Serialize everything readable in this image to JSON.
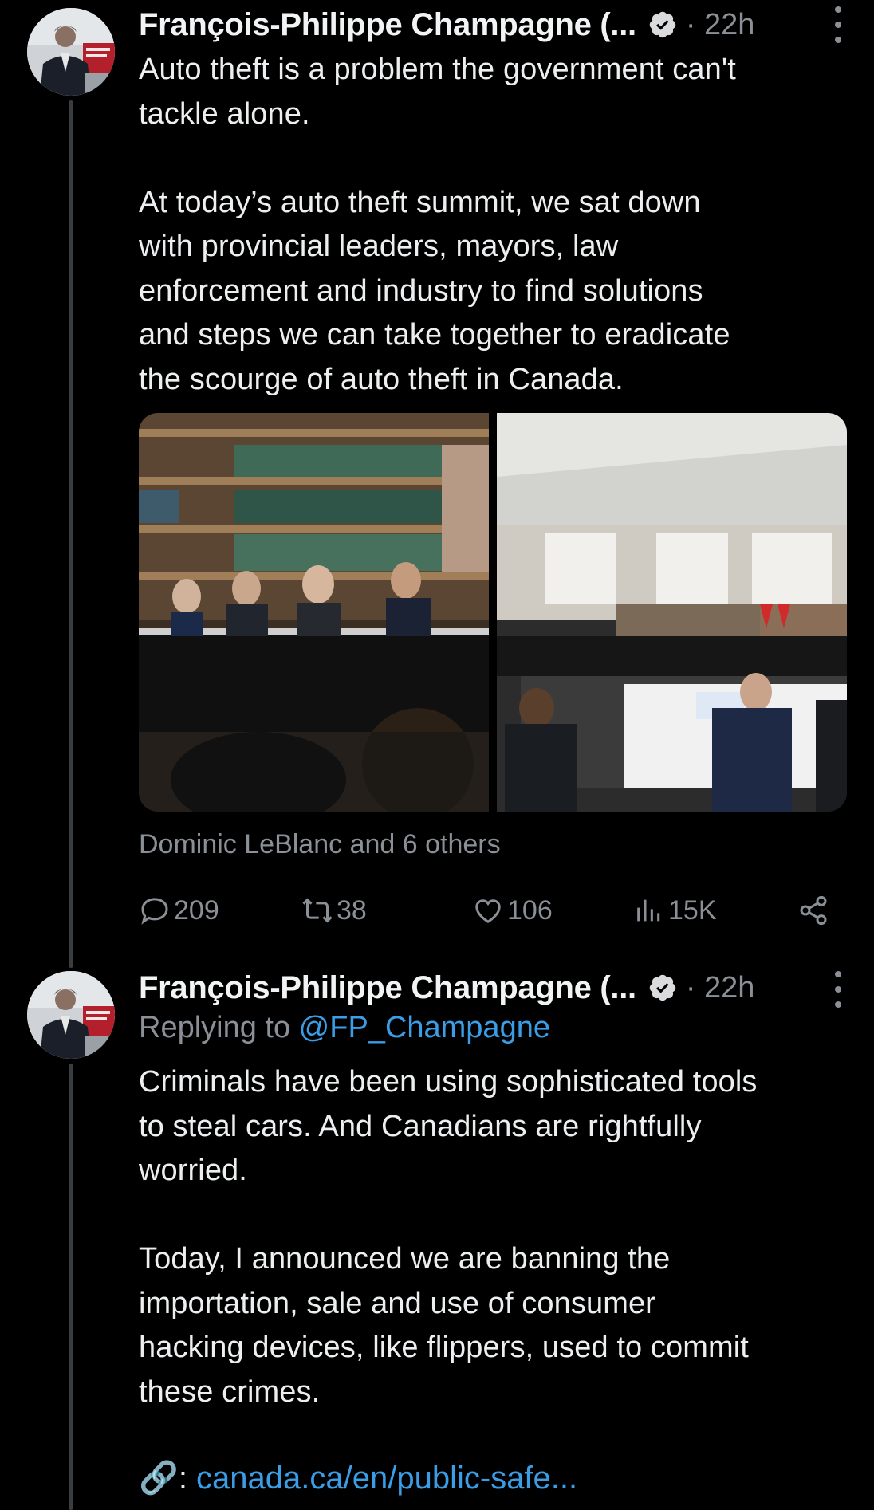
{
  "colors": {
    "background": "#000000",
    "text": "#e7e9ea",
    "muted": "#8b9096",
    "link": "#3a9de6",
    "verified_badge": "#d9dbdd"
  },
  "tweets": [
    {
      "author": "François-Philippe Champagne (...",
      "verified_icon": "verified-badge-icon",
      "time": "· 22h",
      "text": "Auto theft is a problem the government can't\ntackle alone.\n\nAt today’s auto theft summit, we sat down\nwith provincial leaders, mayors, law\nenforcement and industry to find solutions\nand steps we can take together to eradicate\nthe scourge of auto theft in Canada.",
      "images": [
        {
          "description_icon": "photo-icon"
        },
        {
          "description_icon": "photo-icon"
        }
      ],
      "tagged": "Dominic LeBlanc and 6 others",
      "actions": {
        "replies": "209",
        "retweets": "38",
        "likes": "106",
        "views": "15K"
      }
    },
    {
      "author": "François-Philippe Champagne (...",
      "verified_icon": "verified-badge-icon",
      "time": "· 22h",
      "replying_prefix": "Replying to ",
      "replying_handle": "@FP_Champagne",
      "text": "Criminals have been using sophisticated tools\nto steal cars. And Canadians are rightfully\nworried.\n\nToday, I announced we are banning the\nimportation, sale and use of consumer\nhacking devices, like flippers, used to commit\nthese crimes.",
      "link_emoji": "🔗",
      "link_sep": ": ",
      "link_text": "canada.ca/en/public-safe..."
    }
  ]
}
